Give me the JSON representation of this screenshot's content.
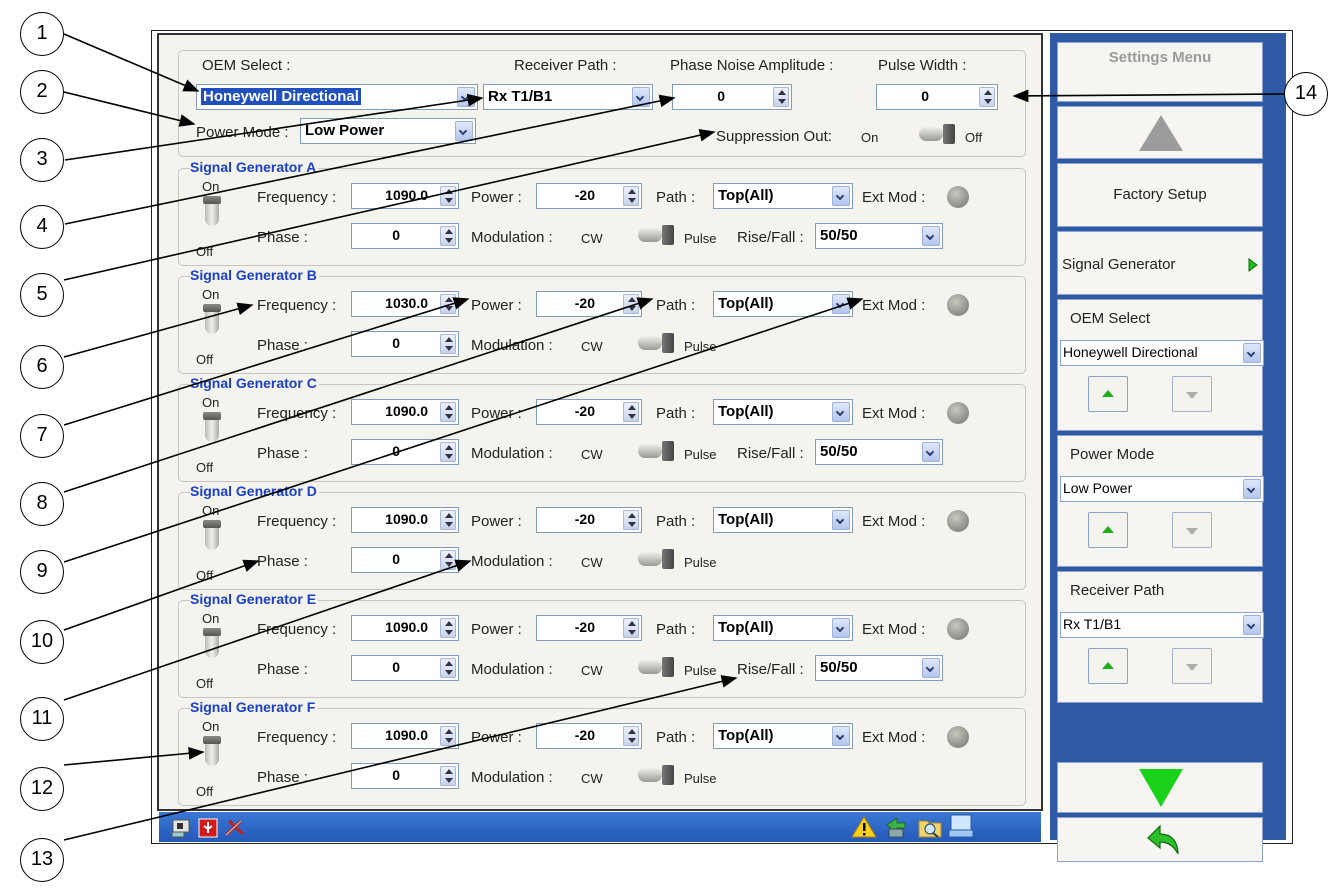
{
  "top": {
    "oem_label": "OEM Select :",
    "oem_value": "Honeywell Directional",
    "receiver_label": "Receiver Path :",
    "receiver_value": "Rx T1/B1",
    "phase_noise_label": "Phase Noise Amplitude :",
    "phase_noise_value": "0",
    "pulse_width_label": "Pulse Width :",
    "pulse_width_value": "0",
    "power_mode_label": "Power Mode :",
    "power_mode_value": "Low Power",
    "suppression_label": "Suppression Out:",
    "on": "On",
    "off": "Off"
  },
  "common": {
    "frequency": "Frequency :",
    "power": "Power :",
    "path": "Path :",
    "ext_mod": "Ext Mod :",
    "phase": "Phase :",
    "modulation": "Modulation :",
    "cw": "CW",
    "pulse": "Pulse",
    "rise_fall": "Rise/Fall :",
    "on": "On",
    "off": "Off"
  },
  "generators": [
    {
      "title": "Signal Generator A",
      "frequency": "1090.0",
      "power": "-20",
      "path": "Top(All)",
      "phase": "0",
      "rise_fall": "50/50"
    },
    {
      "title": "Signal Generator B",
      "frequency": "1030.0",
      "power": "-20",
      "path": "Top(All)",
      "phase": "0"
    },
    {
      "title": "Signal Generator C",
      "frequency": "1090.0",
      "power": "-20",
      "path": "Top(All)",
      "phase": "0",
      "rise_fall": "50/50"
    },
    {
      "title": "Signal Generator D",
      "frequency": "1090.0",
      "power": "-20",
      "path": "Top(All)",
      "phase": "0"
    },
    {
      "title": "Signal Generator E",
      "frequency": "1090.0",
      "power": "-20",
      "path": "Top(All)",
      "phase": "0",
      "rise_fall": "50/50"
    },
    {
      "title": "Signal Generator F",
      "frequency": "1090.0",
      "power": "-20",
      "path": "Top(All)",
      "phase": "0"
    }
  ],
  "side": {
    "title": "Settings Menu",
    "factory_setup": "Factory Setup",
    "signal_generator": "Signal Generator",
    "oem_label": "OEM Select",
    "oem_value": "Honeywell Directional",
    "power_mode_label": "Power Mode",
    "power_mode_value": "Low Power",
    "receiver_label": "Receiver Path",
    "receiver_value": "Rx T1/B1"
  },
  "callouts": [
    "1",
    "2",
    "3",
    "4",
    "5",
    "6",
    "7",
    "8",
    "9",
    "10",
    "11",
    "12",
    "13",
    "14"
  ],
  "colors": {
    "sidebar": "#2f5ba6",
    "title_blue": "#1a40c8",
    "taskbar": "#2a64c4",
    "down_arrow": "#1bd21b"
  }
}
